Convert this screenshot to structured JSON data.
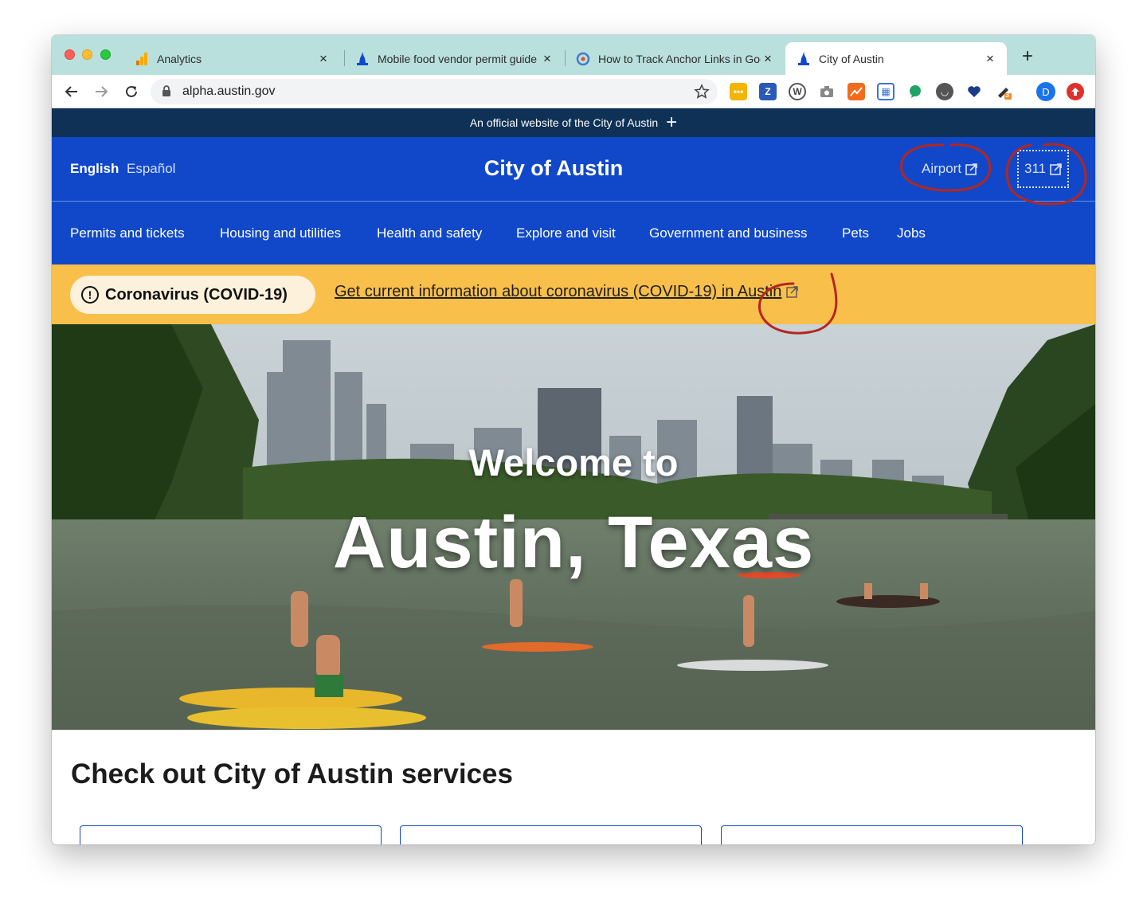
{
  "browser": {
    "tabs": [
      {
        "title": "Analytics",
        "icon": "analytics-icon",
        "active": false
      },
      {
        "title": "Mobile food vendor permit guide",
        "icon": "capitol-icon",
        "active": false
      },
      {
        "title": "How to Track Anchor Links in Google",
        "icon": "tag-manager-icon",
        "active": false
      },
      {
        "title": "City of Austin",
        "icon": "capitol-icon",
        "active": true
      }
    ],
    "close_glyph": "×",
    "new_tab_glyph": "+",
    "url": "alpha.austin.gov",
    "profile_initial": "D",
    "extension_badge": "3"
  },
  "site": {
    "official_banner": "An official website of the City of Austin",
    "official_toggle": "+",
    "languages": {
      "english": "English",
      "spanish": "Español"
    },
    "title": "City of Austin",
    "header_links": {
      "airport": "Airport",
      "threeoneone": "311"
    },
    "nav": [
      "Permits and tickets",
      "Housing and utilities",
      "Health and safety",
      "Explore and visit",
      "Government and business",
      "Pets",
      "Jobs"
    ],
    "alert": {
      "badge_icon": "!",
      "label": "Coronavirus (COVID-19)",
      "link": "Get current information about coronavirus (COVID-19) in Austin"
    },
    "hero": {
      "line1": "Welcome to",
      "line2": "Austin, Texas"
    },
    "services_heading": "Check out City of Austin services"
  },
  "colors": {
    "brand_blue": "#1148c9",
    "banner_navy": "#0f3156",
    "alert_yellow": "#f9bf4b",
    "annotation_red": "#b5261e",
    "tabstrip": "#b9e0dd"
  }
}
